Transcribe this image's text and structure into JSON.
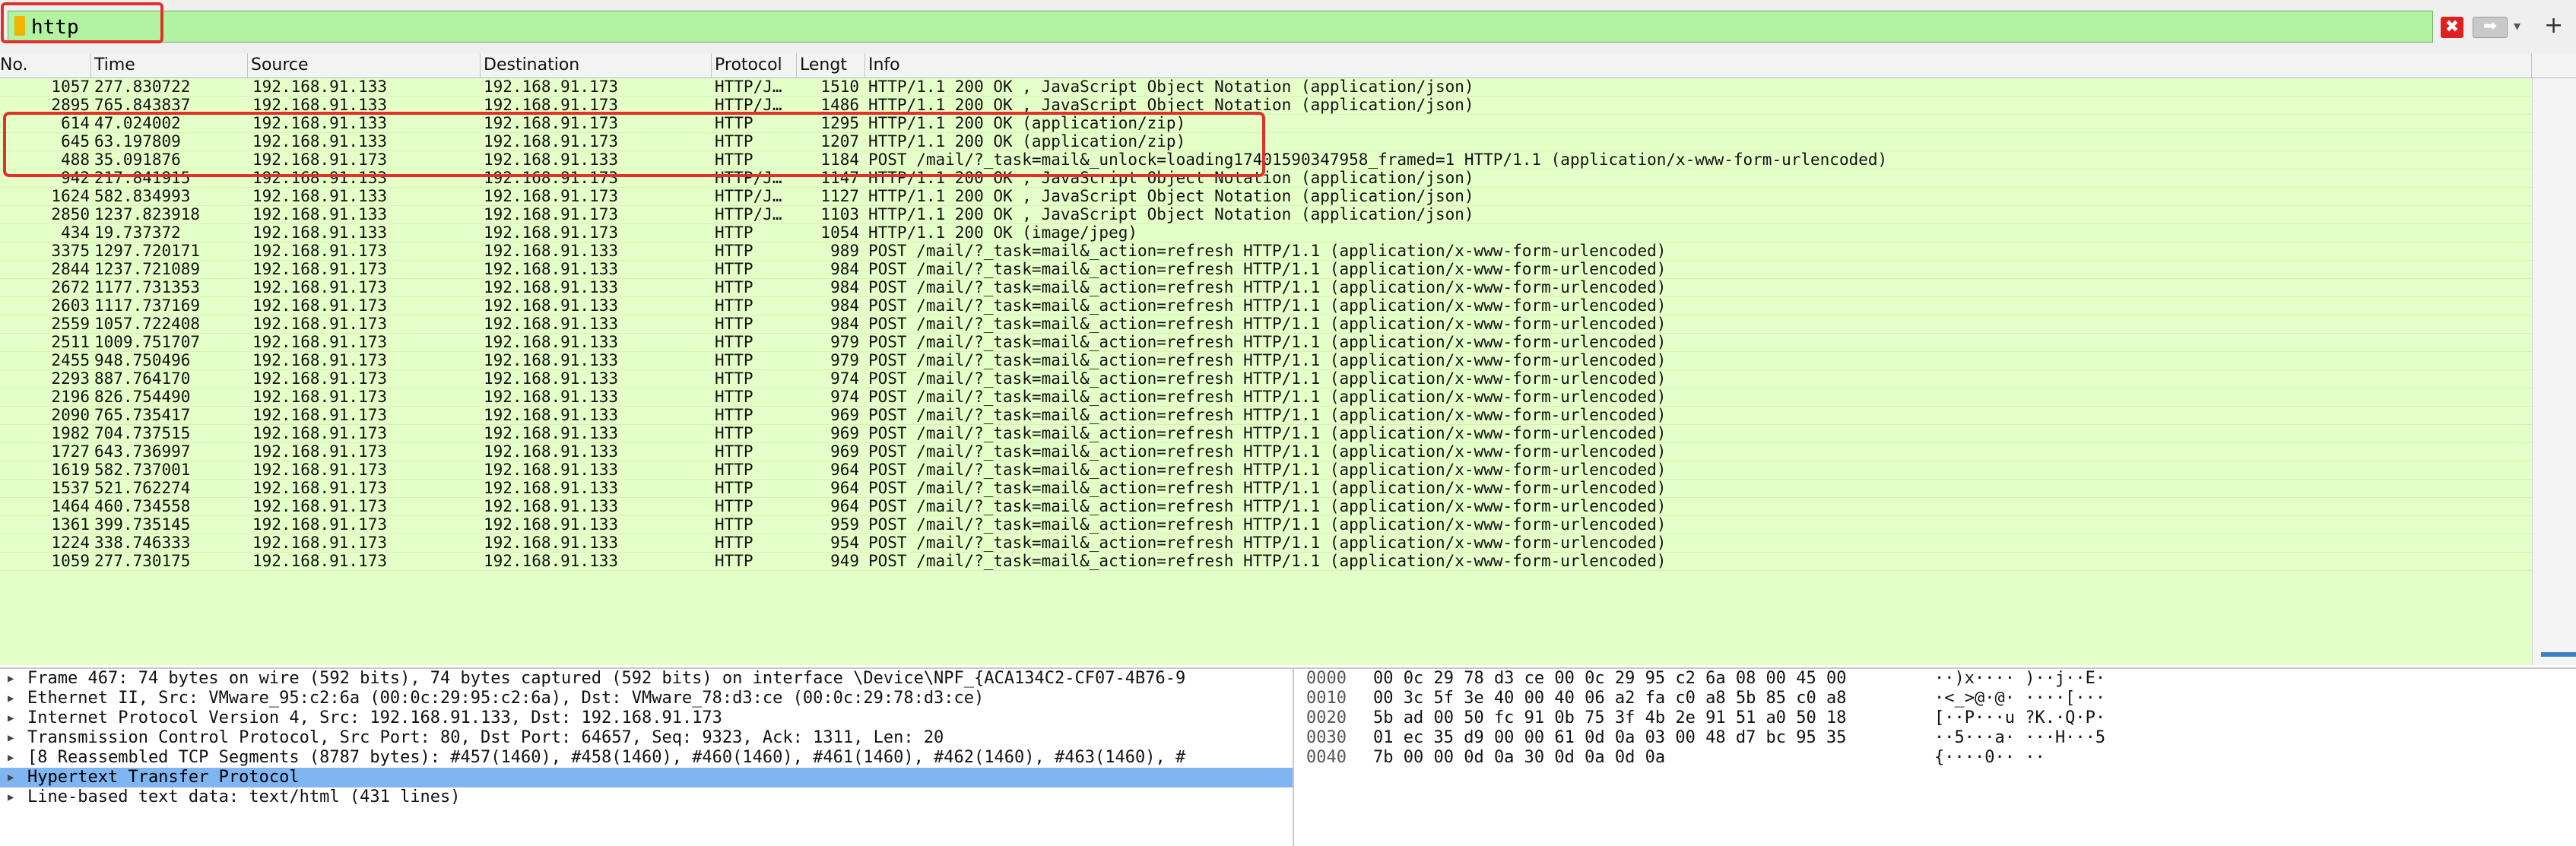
{
  "filter": {
    "value": "http",
    "clear_glyph": "✖",
    "apply_glyph": "➡",
    "dropdown_glyph": "▾",
    "add_glyph": "+"
  },
  "columns": [
    "No.",
    "Time",
    "Source",
    "Destination",
    "Protocol",
    "Lengt",
    "Info"
  ],
  "packets": [
    {
      "no": "1057",
      "time": "277.830722",
      "src": "192.168.91.133",
      "dst": "192.168.91.173",
      "proto": "HTTP/J…",
      "len": "1510",
      "info": "HTTP/1.1 200 OK , JavaScript Object Notation (application/json)"
    },
    {
      "no": "2895",
      "time": "765.843837",
      "src": "192.168.91.133",
      "dst": "192.168.91.173",
      "proto": "HTTP/J…",
      "len": "1486",
      "info": "HTTP/1.1 200 OK , JavaScript Object Notation (application/json)"
    },
    {
      "no": "614",
      "time": "47.024002",
      "src": "192.168.91.133",
      "dst": "192.168.91.173",
      "proto": "HTTP",
      "len": "1295",
      "info": "HTTP/1.1 200 OK  (application/zip)"
    },
    {
      "no": "645",
      "time": "63.197809",
      "src": "192.168.91.133",
      "dst": "192.168.91.173",
      "proto": "HTTP",
      "len": "1207",
      "info": "HTTP/1.1 200 OK  (application/zip)"
    },
    {
      "no": "488",
      "time": "35.091876",
      "src": "192.168.91.173",
      "dst": "192.168.91.133",
      "proto": "HTTP",
      "len": "1184",
      "info": "POST /mail/?_task=mail&_unlock=loading17401590347958_framed=1 HTTP/1.1  (application/x-www-form-urlencoded)"
    },
    {
      "no": "942",
      "time": "217.841915",
      "src": "192.168.91.133",
      "dst": "192.168.91.173",
      "proto": "HTTP/J…",
      "len": "1147",
      "info": "HTTP/1.1 200 OK , JavaScript Object Notation (application/json)"
    },
    {
      "no": "1624",
      "time": "582.834993",
      "src": "192.168.91.133",
      "dst": "192.168.91.173",
      "proto": "HTTP/J…",
      "len": "1127",
      "info": "HTTP/1.1 200 OK , JavaScript Object Notation (application/json)"
    },
    {
      "no": "2850",
      "time": "1237.823918",
      "src": "192.168.91.133",
      "dst": "192.168.91.173",
      "proto": "HTTP/J…",
      "len": "1103",
      "info": "HTTP/1.1 200 OK , JavaScript Object Notation (application/json)"
    },
    {
      "no": "434",
      "time": "19.737372",
      "src": "192.168.91.133",
      "dst": "192.168.91.173",
      "proto": "HTTP",
      "len": "1054",
      "info": "HTTP/1.1 200 OK  (image/jpeg)"
    },
    {
      "no": "3375",
      "time": "1297.720171",
      "src": "192.168.91.173",
      "dst": "192.168.91.133",
      "proto": "HTTP",
      "len": "989",
      "info": "POST /mail/?_task=mail&_action=refresh HTTP/1.1  (application/x-www-form-urlencoded)"
    },
    {
      "no": "2844",
      "time": "1237.721089",
      "src": "192.168.91.173",
      "dst": "192.168.91.133",
      "proto": "HTTP",
      "len": "984",
      "info": "POST /mail/?_task=mail&_action=refresh HTTP/1.1  (application/x-www-form-urlencoded)"
    },
    {
      "no": "2672",
      "time": "1177.731353",
      "src": "192.168.91.173",
      "dst": "192.168.91.133",
      "proto": "HTTP",
      "len": "984",
      "info": "POST /mail/?_task=mail&_action=refresh HTTP/1.1  (application/x-www-form-urlencoded)"
    },
    {
      "no": "2603",
      "time": "1117.737169",
      "src": "192.168.91.173",
      "dst": "192.168.91.133",
      "proto": "HTTP",
      "len": "984",
      "info": "POST /mail/?_task=mail&_action=refresh HTTP/1.1  (application/x-www-form-urlencoded)"
    },
    {
      "no": "2559",
      "time": "1057.722408",
      "src": "192.168.91.173",
      "dst": "192.168.91.133",
      "proto": "HTTP",
      "len": "984",
      "info": "POST /mail/?_task=mail&_action=refresh HTTP/1.1  (application/x-www-form-urlencoded)"
    },
    {
      "no": "2511",
      "time": "1009.751707",
      "src": "192.168.91.173",
      "dst": "192.168.91.133",
      "proto": "HTTP",
      "len": "979",
      "info": "POST /mail/?_task=mail&_action=refresh HTTP/1.1  (application/x-www-form-urlencoded)"
    },
    {
      "no": "2455",
      "time": "948.750496",
      "src": "192.168.91.173",
      "dst": "192.168.91.133",
      "proto": "HTTP",
      "len": "979",
      "info": "POST /mail/?_task=mail&_action=refresh HTTP/1.1  (application/x-www-form-urlencoded)"
    },
    {
      "no": "2293",
      "time": "887.764170",
      "src": "192.168.91.173",
      "dst": "192.168.91.133",
      "proto": "HTTP",
      "len": "974",
      "info": "POST /mail/?_task=mail&_action=refresh HTTP/1.1  (application/x-www-form-urlencoded)"
    },
    {
      "no": "2196",
      "time": "826.754490",
      "src": "192.168.91.173",
      "dst": "192.168.91.133",
      "proto": "HTTP",
      "len": "974",
      "info": "POST /mail/?_task=mail&_action=refresh HTTP/1.1  (application/x-www-form-urlencoded)"
    },
    {
      "no": "2090",
      "time": "765.735417",
      "src": "192.168.91.173",
      "dst": "192.168.91.133",
      "proto": "HTTP",
      "len": "969",
      "info": "POST /mail/?_task=mail&_action=refresh HTTP/1.1  (application/x-www-form-urlencoded)"
    },
    {
      "no": "1982",
      "time": "704.737515",
      "src": "192.168.91.173",
      "dst": "192.168.91.133",
      "proto": "HTTP",
      "len": "969",
      "info": "POST /mail/?_task=mail&_action=refresh HTTP/1.1  (application/x-www-form-urlencoded)"
    },
    {
      "no": "1727",
      "time": "643.736997",
      "src": "192.168.91.173",
      "dst": "192.168.91.133",
      "proto": "HTTP",
      "len": "969",
      "info": "POST /mail/?_task=mail&_action=refresh HTTP/1.1  (application/x-www-form-urlencoded)"
    },
    {
      "no": "1619",
      "time": "582.737001",
      "src": "192.168.91.173",
      "dst": "192.168.91.133",
      "proto": "HTTP",
      "len": "964",
      "info": "POST /mail/?_task=mail&_action=refresh HTTP/1.1  (application/x-www-form-urlencoded)"
    },
    {
      "no": "1537",
      "time": "521.762274",
      "src": "192.168.91.173",
      "dst": "192.168.91.133",
      "proto": "HTTP",
      "len": "964",
      "info": "POST /mail/?_task=mail&_action=refresh HTTP/1.1  (application/x-www-form-urlencoded)"
    },
    {
      "no": "1464",
      "time": "460.734558",
      "src": "192.168.91.173",
      "dst": "192.168.91.133",
      "proto": "HTTP",
      "len": "964",
      "info": "POST /mail/?_task=mail&_action=refresh HTTP/1.1  (application/x-www-form-urlencoded)"
    },
    {
      "no": "1361",
      "time": "399.735145",
      "src": "192.168.91.173",
      "dst": "192.168.91.133",
      "proto": "HTTP",
      "len": "959",
      "info": "POST /mail/?_task=mail&_action=refresh HTTP/1.1  (application/x-www-form-urlencoded)"
    },
    {
      "no": "1224",
      "time": "338.746333",
      "src": "192.168.91.173",
      "dst": "192.168.91.133",
      "proto": "HTTP",
      "len": "954",
      "info": "POST /mail/?_task=mail&_action=refresh HTTP/1.1  (application/x-www-form-urlencoded)"
    },
    {
      "no": "1059",
      "time": "277.730175",
      "src": "192.168.91.173",
      "dst": "192.168.91.133",
      "proto": "HTTP",
      "len": "949",
      "info": "POST /mail/?_task=mail&_action=refresh HTTP/1.1  (application/x-www-form-urlencoded)"
    }
  ],
  "details": [
    {
      "text": "Frame 467: 74 bytes on wire (592 bits), 74 bytes captured (592 bits) on interface \\Device\\NPF_{ACA134C2-CF07-4B76-9",
      "selected": false
    },
    {
      "text": "Ethernet II, Src: VMware_95:c2:6a (00:0c:29:95:c2:6a), Dst: VMware_78:d3:ce (00:0c:29:78:d3:ce)",
      "selected": false
    },
    {
      "text": "Internet Protocol Version 4, Src: 192.168.91.133, Dst: 192.168.91.173",
      "selected": false
    },
    {
      "text": "Transmission Control Protocol, Src Port: 80, Dst Port: 64657, Seq: 9323, Ack: 1311, Len: 20",
      "selected": false
    },
    {
      "text": "[8 Reassembled TCP Segments (8787 bytes): #457(1460), #458(1460), #460(1460), #461(1460), #462(1460), #463(1460), #",
      "selected": false
    },
    {
      "text": "Hypertext Transfer Protocol",
      "selected": true
    },
    {
      "text": "Line-based text data: text/html (431 lines)",
      "selected": false
    }
  ],
  "bytes": [
    {
      "offset": "0000",
      "hex": "00 0c 29 78 d3 ce 00 0c  29 95 c2 6a 08 00 45 00",
      "ascii": "··)x···· )··j··E·"
    },
    {
      "offset": "0010",
      "hex": "00 3c 5f 3e 40 00 40 06  a2 fa c0 a8 5b 85 c0 a8",
      "ascii": "·<_>@·@· ····[···"
    },
    {
      "offset": "0020",
      "hex": "5b ad 00 50 fc 91 0b 75  3f 4b 2e 91 51 a0 50 18",
      "ascii": "[··P···u ?K.·Q·P·"
    },
    {
      "offset": "0030",
      "hex": "01 ec 35 d9 00 00 61 0d  0a 03 00 48 d7 bc 95 35",
      "ascii": "··5···a· ···H···5"
    },
    {
      "offset": "0040",
      "hex": "7b 00 00 0d 0a 30 0d 0a  0d 0a",
      "ascii": "{····0·· ··"
    }
  ],
  "colors": {
    "filter_bg": "#b1f3a0",
    "row_bg": "#e4ffc7",
    "selected_bg": "#7fb6f2",
    "highlight_border": "#e0312a"
  }
}
